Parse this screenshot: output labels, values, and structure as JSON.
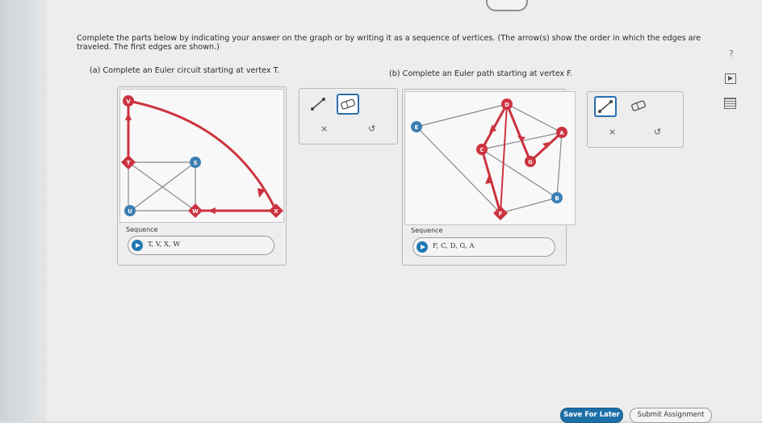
{
  "prompt": {
    "text": "Complete the parts below by indicating your answer on the graph or by writing it as a sequence of vertices. (The arrow(s) show the order in which the edges are traveled. The first edges are shown.)"
  },
  "part_a": {
    "label": "(a) Complete an Euler circuit starting at vertex T.",
    "sequence_label": "Sequence",
    "sequence_value": "T, V, X, W",
    "vertices": [
      "V",
      "T",
      "S",
      "U",
      "W",
      "X"
    ]
  },
  "part_b": {
    "label": "(b) Complete an Euler path starting at vertex F.",
    "sequence_label": "Sequence",
    "sequence_value": "F, C, D, G, A",
    "vertices": [
      "D",
      "E",
      "C",
      "A",
      "G",
      "B",
      "F"
    ]
  },
  "tools": {
    "clear_glyph": "×",
    "undo_glyph": "↺"
  },
  "side": {
    "help_glyph": "?"
  },
  "buttons": {
    "save_label": "Save For Later",
    "submit_label": "Submit Assignment"
  },
  "colors": {
    "highlight": "#cc3340",
    "edge": "#888888",
    "vertex_default": "#3b7fb3",
    "primary_button": "#1d6fa8"
  }
}
